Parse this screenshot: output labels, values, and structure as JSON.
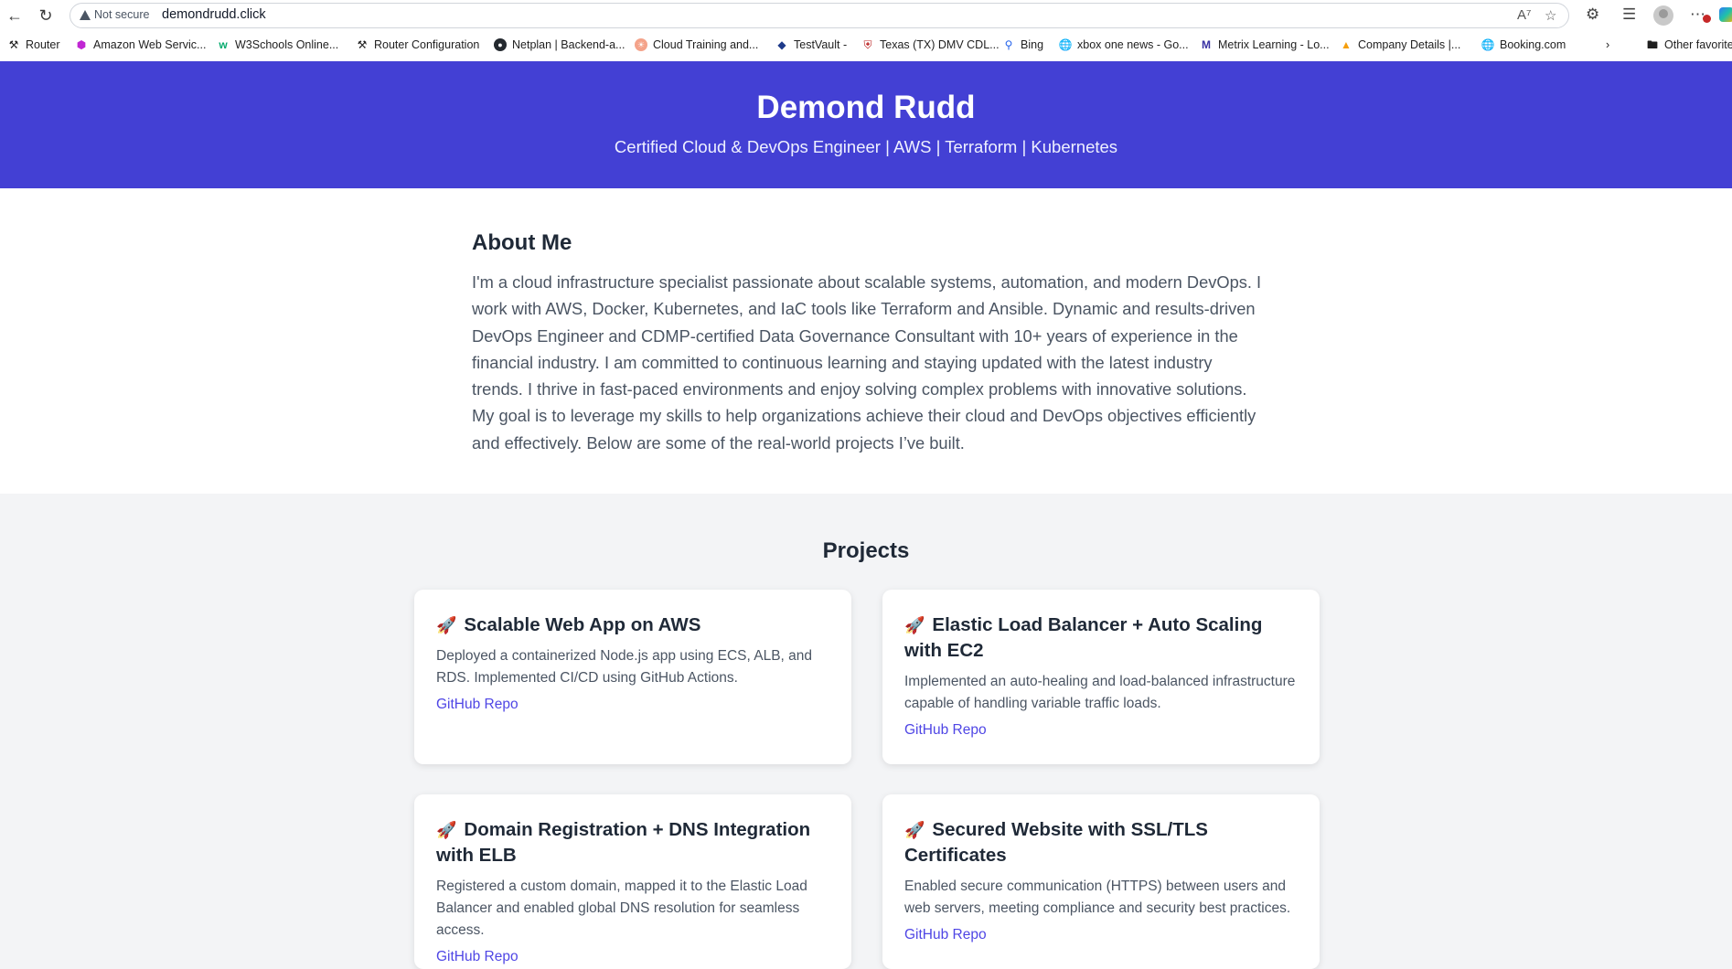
{
  "browser": {
    "security_label": "Not secure",
    "url": "demondrudd.click",
    "bookmarks": [
      {
        "label": "Router",
        "icon": "tools-icon"
      },
      {
        "label": "Amazon Web Servic...",
        "icon": "cube-icon"
      },
      {
        "label": "W3Schools Online...",
        "icon": "w3schools-icon"
      },
      {
        "label": "Router Configuration",
        "icon": "tools-icon"
      },
      {
        "label": "Netplan | Backend-a...",
        "icon": "github-icon"
      },
      {
        "label": "Cloud Training and...",
        "icon": "cloud-training-icon"
      },
      {
        "label": "TestVault -",
        "icon": "testvault-icon"
      },
      {
        "label": "Texas (TX) DMV CDL...",
        "icon": "shield-icon"
      },
      {
        "label": "Bing",
        "icon": "search-icon"
      },
      {
        "label": "xbox one news - Go...",
        "icon": "globe-icon"
      },
      {
        "label": "Metrix Learning - Lo...",
        "icon": "metrix-icon"
      },
      {
        "label": "Company Details |...",
        "icon": "company-icon"
      },
      {
        "label": "Booking.com",
        "icon": "globe-icon"
      }
    ],
    "other_favorites": "Other favorites"
  },
  "hero": {
    "name": "Demond Rudd",
    "tagline": "Certified Cloud & DevOps Engineer | AWS | Terraform | Kubernetes"
  },
  "about": {
    "title": "About Me",
    "text": "I'm a cloud infrastructure specialist passionate about scalable systems, automation, and modern DevOps. I work with AWS, Docker, Kubernetes, and IaC tools like Terraform and Ansible. Dynamic and results-driven DevOps Engineer and CDMP-certified Data Governance Consultant with 10+ years of experience in the financial industry. I am committed to continuous learning and staying updated with the latest industry trends. I thrive in fast-paced environments and enjoy solving complex problems with innovative solutions. My goal is to leverage my skills to help organizations achieve their cloud and DevOps objectives efficiently and effectively. Below are some of the real-world projects I’ve built."
  },
  "projects": {
    "title": "Projects",
    "items": [
      {
        "icon": "🚀",
        "title": "Scalable Web App on AWS",
        "description": "Deployed a containerized Node.js app using ECS, ALB, and RDS. Implemented CI/CD using GitHub Actions.",
        "link": "GitHub Repo"
      },
      {
        "icon": "🚀",
        "title": "Elastic Load Balancer + Auto Scaling with EC2",
        "description": "Implemented an auto-healing and load-balanced infrastructure capable of handling variable traffic loads.",
        "link": "GitHub Repo"
      },
      {
        "icon": "🚀",
        "title": "Domain Registration + DNS Integration with ELB",
        "description": "Registered a custom domain, mapped it to the Elastic Load Balancer and enabled global DNS resolution for seamless access.",
        "link": "GitHub Repo"
      },
      {
        "icon": "🚀",
        "title": "Secured Website with SSL/TLS Certificates",
        "description": "Enabled secure communication (HTTPS) between users and web servers, meeting compliance and security best practices.",
        "link": "GitHub Repo"
      }
    ]
  },
  "colors": {
    "hero_bg": "#4340d4",
    "page_bg": "#f3f4f6",
    "link": "#4f46e5"
  }
}
